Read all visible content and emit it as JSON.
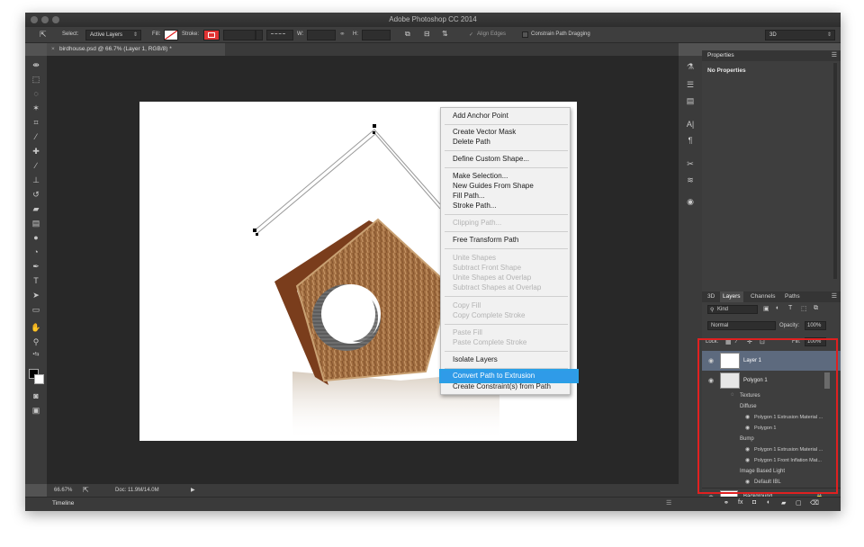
{
  "app": {
    "title": "Adobe Photoshop CC 2014"
  },
  "options_bar": {
    "select_label": "Select:",
    "select_value": "Active Layers",
    "fill_label": "Fill:",
    "stroke_label": "Stroke:",
    "w_label": "W:",
    "h_label": "H:",
    "align_edges": "Align Edges",
    "constrain_label": "Constrain Path Dragging",
    "workspace": "3D"
  },
  "document": {
    "tab_label": "birdhouse.psd @ 66.7% (Layer 1, RGB/8) *",
    "zoom": "66.67%",
    "doc_size": "Doc: 11.9M/14.0M"
  },
  "timeline": {
    "label": "Timeline"
  },
  "context_menu": {
    "items": [
      {
        "label": "Add Anchor Point",
        "enabled": true
      },
      {
        "label": "Create Vector Mask",
        "enabled": true
      },
      {
        "label": "Delete Path",
        "enabled": true
      },
      {
        "label": "Define Custom Shape...",
        "enabled": true
      },
      {
        "label": "Make Selection...",
        "enabled": true
      },
      {
        "label": "New Guides From Shape",
        "enabled": true
      },
      {
        "label": "Fill Path...",
        "enabled": true
      },
      {
        "label": "Stroke Path...",
        "enabled": true
      },
      {
        "label": "Clipping Path...",
        "enabled": false
      },
      {
        "label": "Free Transform Path",
        "enabled": true
      },
      {
        "label": "Unite Shapes",
        "enabled": false
      },
      {
        "label": "Subtract Front Shape",
        "enabled": false
      },
      {
        "label": "Unite Shapes at Overlap",
        "enabled": false
      },
      {
        "label": "Subtract Shapes at Overlap",
        "enabled": false
      },
      {
        "label": "Copy Fill",
        "enabled": false
      },
      {
        "label": "Copy Complete Stroke",
        "enabled": false
      },
      {
        "label": "Paste Fill",
        "enabled": false
      },
      {
        "label": "Paste Complete Stroke",
        "enabled": false
      },
      {
        "label": "Isolate Layers",
        "enabled": true
      },
      {
        "label": "Convert Path to Extrusion",
        "enabled": true,
        "highlighted": true
      },
      {
        "label": "Create Constraint(s) from Path",
        "enabled": true
      }
    ]
  },
  "properties_panel": {
    "title": "Properties",
    "content": "No Properties"
  },
  "layers_panel": {
    "tabs": [
      "3D",
      "Layers",
      "Channels",
      "Paths"
    ],
    "active_tab": "Layers",
    "filter_kind": "Kind",
    "blend_mode": "Normal",
    "opacity_label": "Opacity:",
    "opacity_value": "100%",
    "lock_label": "Lock:",
    "fill_label": "Fill:",
    "fill_value": "100%",
    "layers": [
      {
        "name": "Layer 1"
      },
      {
        "name": "Polygon 1"
      },
      {
        "name": "Textures"
      },
      {
        "name": "Diffuse"
      },
      {
        "name": "Polygon 1 Extrusion Material ..."
      },
      {
        "name": "Polygon 1"
      },
      {
        "name": "Bump"
      },
      {
        "name": "Polygon 1 Extrusion Material ..."
      },
      {
        "name": "Polygon 1 Front Inflation Mat..."
      },
      {
        "name": "Image Based Light"
      },
      {
        "name": "Default IBL"
      },
      {
        "name": "Background"
      }
    ]
  },
  "colors": {
    "highlight_outline": "#e02020",
    "menu_highlight": "#2f9be8",
    "selected_layer": "#5d6a7e"
  }
}
